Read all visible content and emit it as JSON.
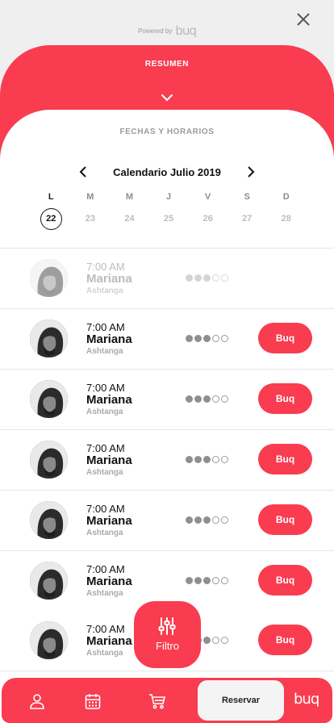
{
  "header": {
    "powered_label": "Powered by",
    "logo_text": "buq"
  },
  "summary": {
    "title": "RESUMEN"
  },
  "schedule": {
    "section_title": "FECHAS Y HORARIOS",
    "calendar_title": "Calendario Julio 2019",
    "weekdays": [
      "L",
      "M",
      "M",
      "J",
      "V",
      "S",
      "D"
    ],
    "dates": [
      "22",
      "23",
      "24",
      "25",
      "26",
      "27",
      "28"
    ],
    "selected_date": "22"
  },
  "classes": [
    {
      "time": "7:00 AM",
      "instructor": "Mariana",
      "type": "Ashtanga",
      "level": 3,
      "level_max": 5,
      "available": false,
      "button": ""
    },
    {
      "time": "7:00 AM",
      "instructor": "Mariana",
      "type": "Ashtanga",
      "level": 3,
      "level_max": 5,
      "available": true,
      "button": "Buq"
    },
    {
      "time": "7:00 AM",
      "instructor": "Mariana",
      "type": "Ashtanga",
      "level": 3,
      "level_max": 5,
      "available": true,
      "button": "Buq"
    },
    {
      "time": "7:00 AM",
      "instructor": "Mariana",
      "type": "Ashtanga",
      "level": 3,
      "level_max": 5,
      "available": true,
      "button": "Buq"
    },
    {
      "time": "7:00 AM",
      "instructor": "Mariana",
      "type": "Ashtanga",
      "level": 3,
      "level_max": 5,
      "available": true,
      "button": "Buq"
    },
    {
      "time": "7:00 AM",
      "instructor": "Mariana",
      "type": "Ashtanga",
      "level": 3,
      "level_max": 5,
      "available": true,
      "button": "Buq"
    },
    {
      "time": "7:00 AM",
      "instructor": "Mariana",
      "type": "Ashtanga",
      "level": 3,
      "level_max": 5,
      "available": true,
      "button": "Buq"
    }
  ],
  "filter": {
    "label": "Filtro",
    "icon": "sliders-icon"
  },
  "bottom_nav": {
    "items": [
      {
        "icon": "user-icon"
      },
      {
        "icon": "calendar-icon"
      },
      {
        "icon": "cart-icon"
      }
    ],
    "reserve_label": "Reservar",
    "logo_text": "buq"
  },
  "colors": {
    "accent": "#f93c4f",
    "background": "#efefef"
  }
}
